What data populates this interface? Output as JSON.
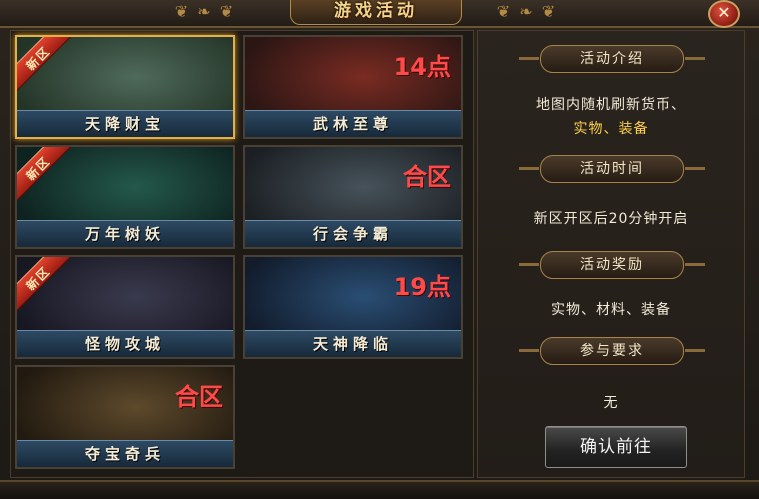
{
  "window": {
    "title": "游戏活动",
    "close_label": "✕",
    "ornament_glyph": "❦ ❧ ❦",
    "colors": {
      "accent_gold": "#e3b04a",
      "new_badge": "#c8321f",
      "note_red": "#ff4a4a",
      "label_bar": "#24405a"
    }
  },
  "activities": [
    {
      "name": "天降财宝",
      "badge": "新区",
      "note": "",
      "selected": true,
      "art_colors": [
        "#4f6a5a",
        "#243528"
      ]
    },
    {
      "name": "武林至尊",
      "badge": "",
      "note": "14点",
      "selected": false,
      "art_colors": [
        "#7a2b22",
        "#2b1614"
      ]
    },
    {
      "name": "万年树妖",
      "badge": "新区",
      "note": "",
      "selected": false,
      "art_colors": [
        "#24594a",
        "#0e2220"
      ]
    },
    {
      "name": "行会争霸",
      "badge": "",
      "note": "合区",
      "selected": false,
      "art_colors": [
        "#46525a",
        "#1c2024"
      ]
    },
    {
      "name": "怪物攻城",
      "badge": "新区",
      "note": "",
      "selected": false,
      "art_colors": [
        "#3a3a4e",
        "#171722"
      ]
    },
    {
      "name": "天神降临",
      "badge": "",
      "note": "19点",
      "selected": false,
      "art_colors": [
        "#2a4e74",
        "#121c2c"
      ]
    },
    {
      "name": "夺宝奇兵",
      "badge": "",
      "note": "合区",
      "selected": false,
      "art_colors": [
        "#5e4a2c",
        "#221a10"
      ]
    }
  ],
  "detail": {
    "intro_heading": "活动介绍",
    "intro_line1": "地图内随机刷新货币、",
    "intro_line2": "实物、装备",
    "time_heading": "活动时间",
    "time_text": "新区开区后20分钟开启",
    "reward_heading": "活动奖励",
    "reward_text": "实物、材料、装备",
    "requirement_heading": "参与要求",
    "requirement_text": "无",
    "confirm_label": "确认前往"
  }
}
